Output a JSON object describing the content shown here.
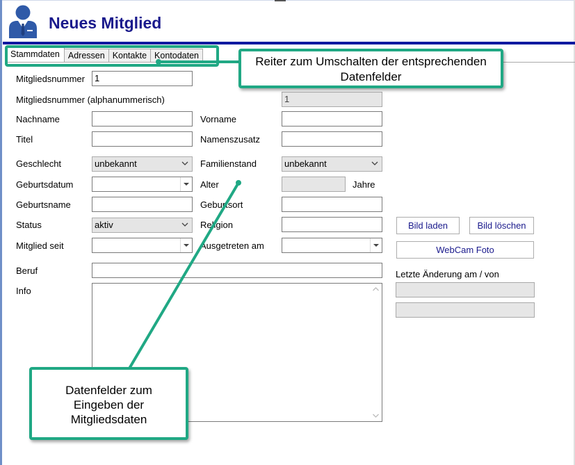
{
  "header": {
    "title": "Neues Mitglied",
    "avatar_icon": "user-avatar-icon",
    "accent_color": "#0b1aa0",
    "title_color": "#1a1a8c"
  },
  "tabs": [
    {
      "label": "Stammdaten",
      "active": true
    },
    {
      "label": "Adressen",
      "active": false
    },
    {
      "label": "Kontakte",
      "active": false
    },
    {
      "label": "Kontodaten",
      "active": false
    }
  ],
  "form": {
    "mitgliedsnummer": {
      "label": "Mitgliedsnummer",
      "value": "1"
    },
    "mitgliedsnummer_alpha": {
      "label": "Mitgliedsnummer (alphanummerisch)",
      "value": "1"
    },
    "nachname": {
      "label": "Nachname",
      "value": ""
    },
    "vorname": {
      "label": "Vorname",
      "value": ""
    },
    "titel": {
      "label": "Titel",
      "value": ""
    },
    "namenszusatz": {
      "label": "Namenszusatz",
      "value": ""
    },
    "geschlecht": {
      "label": "Geschlecht",
      "value": "unbekannt"
    },
    "familienstand": {
      "label": "Familienstand",
      "value": "unbekannt"
    },
    "geburtsdatum": {
      "label": "Geburtsdatum",
      "value": ""
    },
    "alter": {
      "label": "Alter",
      "value": "",
      "unit": "Jahre"
    },
    "geburtsname": {
      "label": "Geburtsname",
      "value": ""
    },
    "geburtsort": {
      "label": "Geburtsort",
      "value": ""
    },
    "status": {
      "label": "Status",
      "value": "aktiv"
    },
    "religion": {
      "label": "Religion",
      "value": ""
    },
    "mitglied_seit": {
      "label": "Mitglied seit",
      "value": ""
    },
    "ausgetreten_am": {
      "label": "Ausgetreten am",
      "value": ""
    },
    "beruf": {
      "label": "Beruf",
      "value": ""
    },
    "info": {
      "label": "Info",
      "value": ""
    }
  },
  "side": {
    "bild_laden": "Bild laden",
    "bild_loeschen": "Bild löschen",
    "webcam_foto": "WebCam Foto",
    "letzte_aenderung_label": "Letzte Änderung am / von",
    "letzte_aenderung_am": "",
    "letzte_aenderung_von": ""
  },
  "callouts": {
    "tabs_note": "Reiter zum Umschalten der entsprechenden Datenfelder",
    "fields_note_lines": [
      "Datenfelder zum",
      "Eingeben der",
      "Mitgliedsdaten"
    ],
    "color": "#20a884"
  }
}
